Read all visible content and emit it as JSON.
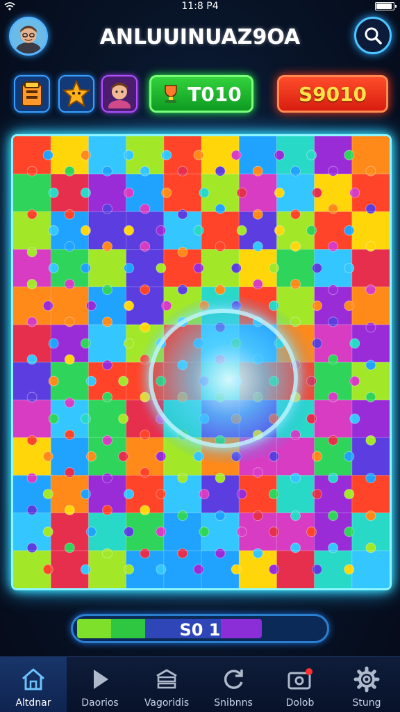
{
  "status_bar": {
    "time": "11:8 P4"
  },
  "header": {
    "title": "ANLUUINUAZ9OA",
    "avatar_icon": "avatar-icon",
    "search_icon": "search-icon"
  },
  "toolbar": {
    "buttons": [
      {
        "icon": "treasure-box-icon"
      },
      {
        "icon": "star-character-icon"
      },
      {
        "icon": "character-portrait-icon"
      }
    ],
    "green_pill": {
      "label": "T010",
      "icon": "trophy-icon"
    },
    "red_pill": {
      "label": "S9010"
    }
  },
  "board": {
    "rows": 12,
    "cols": 10
  },
  "progress": {
    "label": "S0 1",
    "value": 0.75
  },
  "nav": {
    "items": [
      {
        "label": "Altdnar",
        "icon": "home-icon",
        "active": true
      },
      {
        "label": "Daorios",
        "icon": "play-icon",
        "active": false
      },
      {
        "label": "Vagoridis",
        "icon": "stack-icon",
        "active": false
      },
      {
        "label": "Snibnns",
        "icon": "refresh-icon",
        "active": false
      },
      {
        "label": "Dolob",
        "icon": "camera-badge-icon",
        "active": false
      },
      {
        "label": "Stung",
        "icon": "gear-icon",
        "active": false
      }
    ]
  },
  "colors": {
    "accent": "#3ef0ff",
    "green": "#28d43a",
    "red": "#ff3a1a",
    "puzzle": [
      "#1fa3ff",
      "#34c7ff",
      "#a2e829",
      "#2fd55a",
      "#ff8a1a",
      "#ff4429",
      "#ffd60a",
      "#9a2cd8",
      "#d73cc2",
      "#e62f4d",
      "#29d9c8",
      "#5b3de0"
    ]
  }
}
